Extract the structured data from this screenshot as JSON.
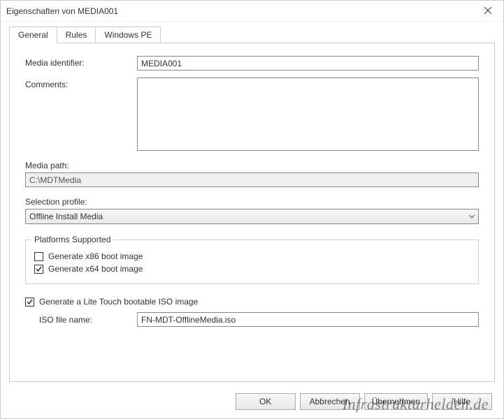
{
  "window": {
    "title": "Eigenschaften von MEDIA001"
  },
  "tabs": {
    "general": "General",
    "rules": "Rules",
    "winpe": "Windows PE"
  },
  "fields": {
    "media_identifier_label": "Media identifier:",
    "media_identifier_value": "MEDIA001",
    "comments_label": "Comments:",
    "comments_value": "",
    "media_path_label": "Media path:",
    "media_path_value": "C:\\MDTMedia",
    "selection_profile_label": "Selection profile:",
    "selection_profile_value": "Offline Install Media"
  },
  "platforms": {
    "legend": "Platforms Supported",
    "x86_label": "Generate x86 boot image",
    "x86_checked": false,
    "x64_label": "Generate x64 boot image",
    "x64_checked": true
  },
  "iso": {
    "gen_label": "Generate a Lite Touch bootable ISO image",
    "gen_checked": true,
    "filename_label": "ISO file name:",
    "filename_value": "FN-MDT-OfflineMedia.iso"
  },
  "buttons": {
    "ok": "OK",
    "cancel": "Abbrechen",
    "apply": "Übernehmen",
    "help": "Hilfe"
  },
  "watermark": "Infrastrukturhelden.de"
}
